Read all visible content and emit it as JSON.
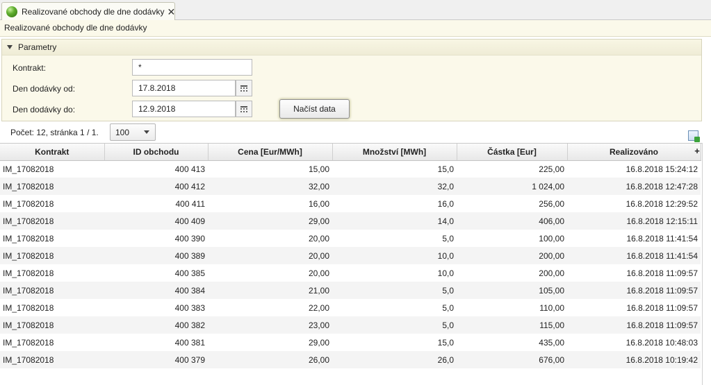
{
  "tab": {
    "title": "Realizované obchody dle dne dodávky",
    "close": "✕"
  },
  "subtitle": "Realizované obchody dle dne dodávky",
  "params": {
    "header": "Parametry",
    "contract_label": "Kontrakt:",
    "contract_value": "*",
    "from_label": "Den dodávky od:",
    "from_value": "17.8.2018",
    "to_label": "Den dodávky do:",
    "to_value": "12.9.2018",
    "load_button": "Načíst data"
  },
  "paging": {
    "count_text": "Počet: 12, stránka 1 / 1.",
    "page_size": "100"
  },
  "grid": {
    "columns": [
      "Kontrakt",
      "ID obchodu",
      "Cena [Eur/MWh]",
      "Množství [MWh]",
      "Částka [Eur]",
      "Realizováno"
    ],
    "add_column": "+",
    "rows": [
      [
        "IM_17082018",
        "400 413",
        "15,00",
        "15,0",
        "225,00",
        "16.8.2018 15:24:12"
      ],
      [
        "IM_17082018",
        "400 412",
        "32,00",
        "32,0",
        "1 024,00",
        "16.8.2018 12:47:28"
      ],
      [
        "IM_17082018",
        "400 411",
        "16,00",
        "16,0",
        "256,00",
        "16.8.2018 12:29:52"
      ],
      [
        "IM_17082018",
        "400 409",
        "29,00",
        "14,0",
        "406,00",
        "16.8.2018 12:15:11"
      ],
      [
        "IM_17082018",
        "400 390",
        "20,00",
        "5,0",
        "100,00",
        "16.8.2018 11:41:54"
      ],
      [
        "IM_17082018",
        "400 389",
        "20,00",
        "10,0",
        "200,00",
        "16.8.2018 11:41:54"
      ],
      [
        "IM_17082018",
        "400 385",
        "20,00",
        "10,0",
        "200,00",
        "16.8.2018 11:09:57"
      ],
      [
        "IM_17082018",
        "400 384",
        "21,00",
        "5,0",
        "105,00",
        "16.8.2018 11:09:57"
      ],
      [
        "IM_17082018",
        "400 383",
        "22,00",
        "5,0",
        "110,00",
        "16.8.2018 11:09:57"
      ],
      [
        "IM_17082018",
        "400 382",
        "23,00",
        "5,0",
        "115,00",
        "16.8.2018 11:09:57"
      ],
      [
        "IM_17082018",
        "400 381",
        "29,00",
        "15,0",
        "435,00",
        "16.8.2018 10:48:03"
      ],
      [
        "IM_17082018",
        "400 379",
        "26,00",
        "26,0",
        "676,00",
        "16.8.2018 10:19:42"
      ]
    ]
  }
}
